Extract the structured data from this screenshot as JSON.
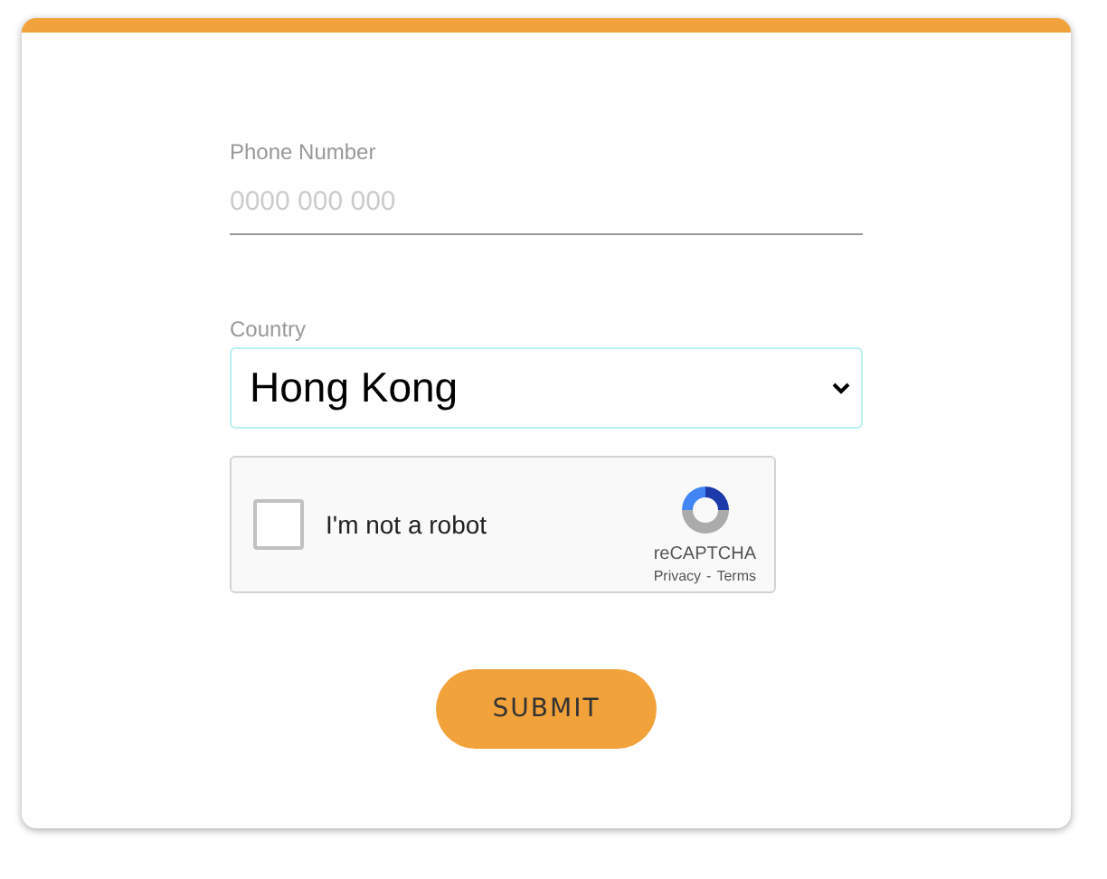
{
  "phone": {
    "label": "Phone Number",
    "placeholder": "0000 000 000"
  },
  "country": {
    "label": "Country",
    "value": "Hong Kong"
  },
  "captcha": {
    "label": "I'm not a robot",
    "checked": false,
    "brand": "reCAPTCHA",
    "privacy": "Privacy",
    "separator": "-",
    "terms": "Terms"
  },
  "submit": "SUBMIT"
}
